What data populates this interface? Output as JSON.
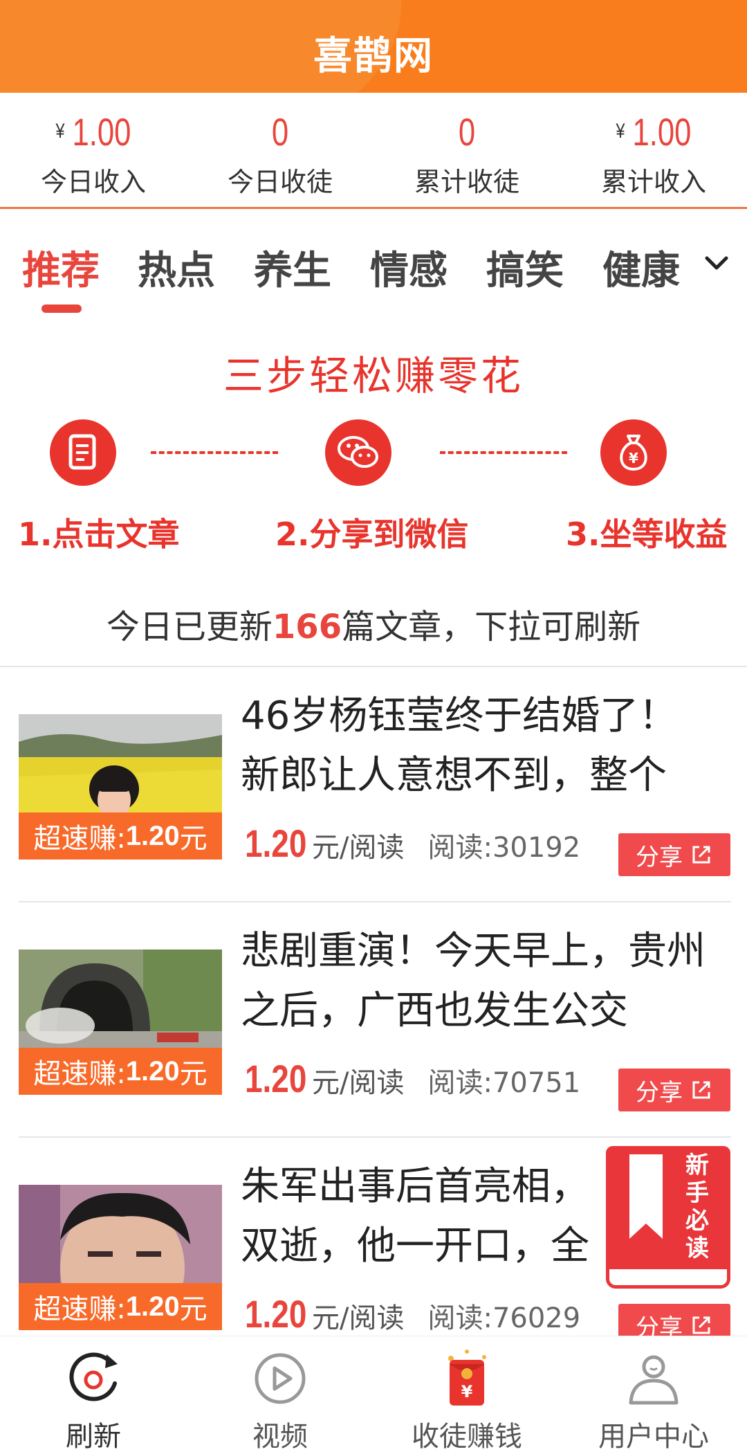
{
  "header": {
    "title": "喜鹊网"
  },
  "stats": [
    {
      "currency": "¥",
      "value": "1.00",
      "label": "今日收入"
    },
    {
      "currency": "",
      "value": "0",
      "label": "今日收徒"
    },
    {
      "currency": "",
      "value": "0",
      "label": "累计收徒"
    },
    {
      "currency": "¥",
      "value": "1.00",
      "label": "累计收入"
    }
  ],
  "tabs": [
    "推荐",
    "热点",
    "养生",
    "情感",
    "搞笑",
    "健康"
  ],
  "active_tab": "推荐",
  "banner": {
    "title": "三步轻松赚零花",
    "steps": [
      "1.点击文章",
      "2.分享到微信",
      "3.坐等收益"
    ]
  },
  "update": {
    "prefix": "今日已更新",
    "count": "166",
    "suffix": "篇文章，下拉可刷新"
  },
  "articles": [
    {
      "title": "46岁杨钰莹终于结婚了！新郎让人意想不到，整个",
      "earn_prefix": "超速赚:",
      "earn_amount": "1.20",
      "earn_suffix": "元",
      "price": "1.20",
      "unit": "元/阅读",
      "reads": "阅读:30192",
      "share": "分享"
    },
    {
      "title": "悲剧重演！今天早上，贵州之后，广西也发生公交",
      "earn_prefix": "超速赚:",
      "earn_amount": "1.20",
      "earn_suffix": "元",
      "price": "1.20",
      "unit": "元/阅读",
      "reads": "阅读:70751",
      "share": "分享"
    },
    {
      "title": "朱军出事后首亮相，双逝，他一开口，全",
      "earn_prefix": "超速赚:",
      "earn_amount": "1.20",
      "earn_suffix": "元",
      "price": "1.20",
      "unit": "元/阅读",
      "reads": "阅读:76029",
      "share": "分享"
    }
  ],
  "float_guide": {
    "text": "新手必读"
  },
  "bottom_nav": [
    {
      "label": "刷新",
      "icon": "refresh-icon"
    },
    {
      "label": "视频",
      "icon": "play-icon"
    },
    {
      "label": "收徒赚钱",
      "icon": "red-envelope-icon"
    },
    {
      "label": "用户中心",
      "icon": "user-icon"
    }
  ],
  "colors": {
    "header": "#f97d1c",
    "accent": "#e8453c",
    "earn_badge": "#f86a2a",
    "share_button": "#f04a4c"
  }
}
